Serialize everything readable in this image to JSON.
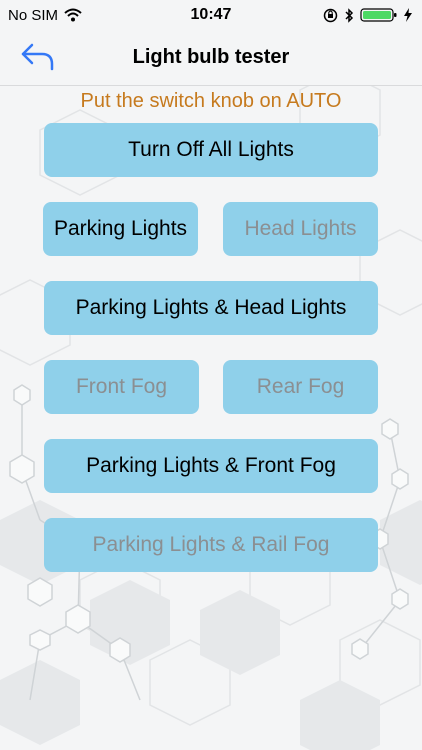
{
  "status_bar": {
    "carrier": "No SIM",
    "time": "10:47",
    "icons": [
      "wifi-icon",
      "orientation-lock-icon",
      "bluetooth-icon",
      "battery-icon",
      "charging-icon"
    ]
  },
  "nav": {
    "title": "Light bulb tester",
    "back_icon": "back-arrow-icon"
  },
  "instruction": "Put the switch knob on AUTO",
  "buttons": {
    "turn_off_all": "Turn Off All Lights",
    "parking_lights": "Parking Lights",
    "head_lights": "Head Lights",
    "parking_and_head": "Parking Lights & Head Lights",
    "front_fog": "Front Fog",
    "rear_fog": "Rear Fog",
    "parking_and_front_fog": "Parking Lights & Front Fog",
    "parking_and_rail_fog": "Parking Lights & Rail Fog"
  },
  "button_states": {
    "head_lights": "disabled",
    "front_fog": "disabled",
    "rear_fog": "disabled",
    "parking_and_rail_fog": "disabled"
  },
  "colors": {
    "accent": "#3478f6",
    "button_bg": "#8fd0ea",
    "instruction": "#c67a1e",
    "disabled_text": "#8b8f92",
    "battery_fill": "#4cd964"
  }
}
